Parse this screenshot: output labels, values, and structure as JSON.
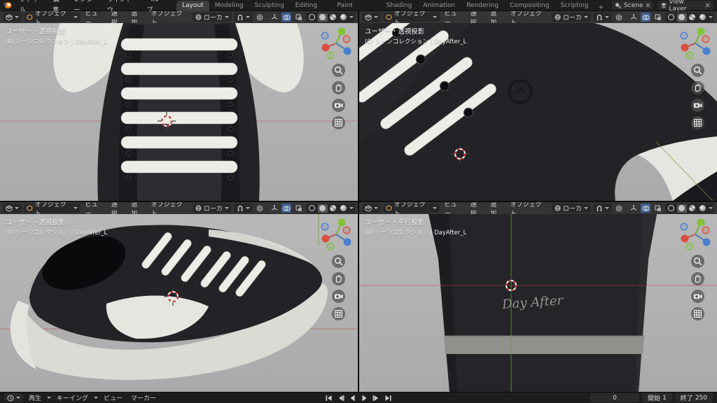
{
  "topbar": {
    "menus": [
      "ファイル",
      "編集",
      "レンダー",
      "ウィンドウ",
      "ヘルプ"
    ],
    "tabs": [
      "Layout",
      "Modeling",
      "Sculpting",
      "UV Editing",
      "Texture Paint",
      "Shading",
      "Animation",
      "Rendering",
      "Compositing",
      "Scripting"
    ],
    "new_workspace_tab": "+",
    "scene_label": "Scene",
    "view_layer_label": "View Layer"
  },
  "viewport_header": {
    "mode_label": "オブジェクト",
    "menus": [
      "ビュー",
      "選択",
      "追加",
      "オブジェクト"
    ],
    "orientation_label": "ローカ"
  },
  "viewports": [
    {
      "projection": "ユーザー・透視投影",
      "collection_info": "(0) シーンコレクション | DayAfter_L"
    },
    {
      "projection": "ユーザー・透視投影",
      "collection_info": "(0) シーンコレクション | DayAfter_L"
    },
    {
      "projection": "ユーザー・透視投影",
      "collection_info": "(0) シーンコレクション | DayAfter_L"
    },
    {
      "projection": "ユーザー・平行投影",
      "collection_info": "(0) シーンコレクション | DayAfter_L"
    }
  ],
  "scene_objects": {
    "sole_text": "Day After"
  },
  "timeline": {
    "menus": [
      "再生",
      "キーイング",
      "ビュー",
      "マーカー"
    ],
    "frame_value": "0",
    "start_label": "開始",
    "start_value": "1",
    "end_label": "終了",
    "end_value": "250"
  },
  "colors": {
    "accent_blue": "#4772b3",
    "axis_red": "#c24641",
    "axis_green": "#6fa843",
    "viewport_bg": "#b3b3b3",
    "shoe_dark": "#232327",
    "lace_white": "#edece6"
  }
}
